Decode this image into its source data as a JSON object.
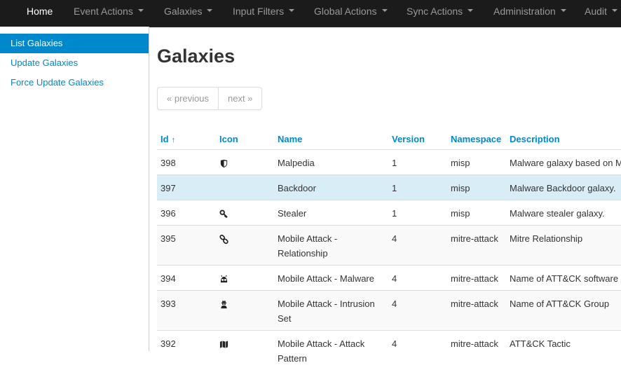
{
  "nav": {
    "home": "Home",
    "menus": [
      "Event Actions",
      "Galaxies",
      "Input Filters",
      "Global Actions",
      "Sync Actions",
      "Administration",
      "Audit"
    ]
  },
  "sidebar": {
    "items": [
      "List Galaxies",
      "Update Galaxies",
      "Force Update Galaxies"
    ]
  },
  "page": {
    "title": "Galaxies",
    "pager": {
      "previous": "« previous",
      "next": "next »"
    }
  },
  "table": {
    "headers": [
      "Id",
      "Icon",
      "Name",
      "Version",
      "Namespace",
      "Description"
    ],
    "sort_indicator": "↑",
    "rows": [
      {
        "id": "398",
        "icon": "shield-icon",
        "name": "Malpedia",
        "version": "1",
        "namespace": "misp",
        "description": "Malware galaxy based on Malpedia"
      },
      {
        "id": "397",
        "icon": "",
        "name": "Backdoor",
        "version": "1",
        "namespace": "misp",
        "description": "Malware Backdoor galaxy."
      },
      {
        "id": "396",
        "icon": "key-icon",
        "name": "Stealer",
        "version": "1",
        "namespace": "misp",
        "description": "Malware stealer galaxy."
      },
      {
        "id": "395",
        "icon": "link-icon",
        "name": "Mobile Attack - Relationship",
        "version": "4",
        "namespace": "mitre-attack",
        "description": "Mitre Relationship"
      },
      {
        "id": "394",
        "icon": "optin-monster-icon",
        "name": "Mobile Attack - Malware",
        "version": "4",
        "namespace": "mitre-attack",
        "description": "Name of ATT&CK software"
      },
      {
        "id": "393",
        "icon": "user-secret-icon",
        "name": "Mobile Attack - Intrusion Set",
        "version": "4",
        "namespace": "mitre-attack",
        "description": "Name of ATT&CK Group"
      },
      {
        "id": "392",
        "icon": "map-icon",
        "name": "Mobile Attack - Attack Pattern",
        "version": "4",
        "namespace": "mitre-attack",
        "description": "ATT&CK Tactic"
      }
    ]
  }
}
